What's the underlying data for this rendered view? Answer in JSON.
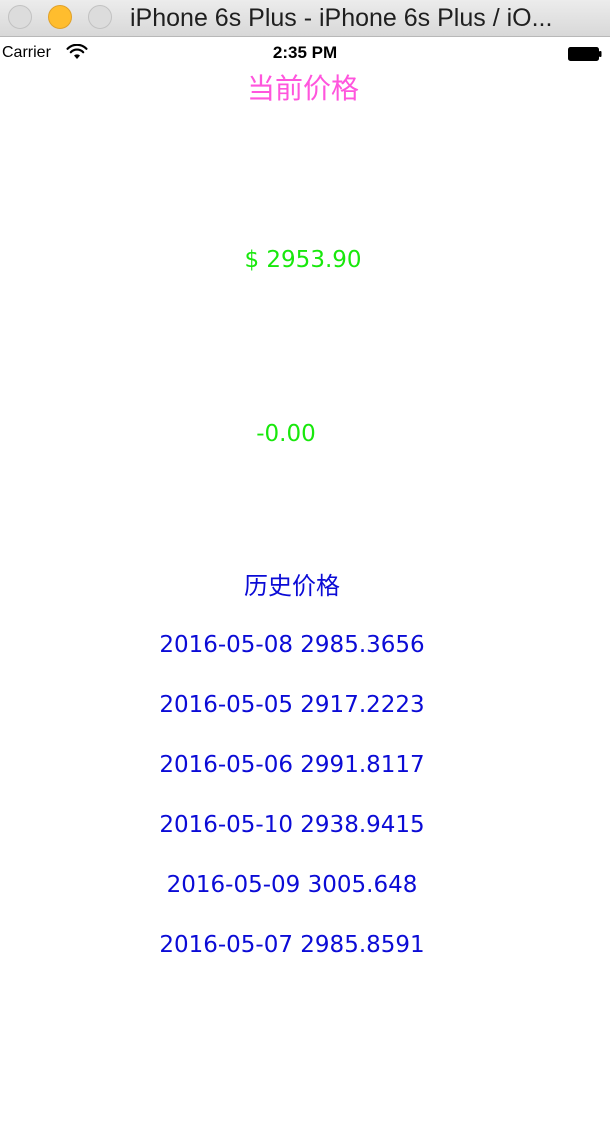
{
  "window": {
    "title": "iPhone 6s Plus - iPhone 6s Plus / iO..."
  },
  "statusbar": {
    "carrier": "Carrier",
    "time": "2:35 PM",
    "icons": [
      "wifi-icon",
      "battery-icon"
    ]
  },
  "app": {
    "current_heading": "当前价格",
    "current_price": "$ 2953.90",
    "change": "-0.00",
    "history_heading": "历史价格",
    "history": [
      "2016-05-08 2985.3656",
      "2016-05-05 2917.2223",
      "2016-05-06 2991.8117",
      "2016-05-10 2938.9415",
      "2016-05-09 3005.648",
      "2016-05-07 2985.8591"
    ]
  },
  "colors": {
    "heading_pink": "#ff55dd",
    "price_green": "#18e80c",
    "history_blue": "#0b0bd6"
  }
}
